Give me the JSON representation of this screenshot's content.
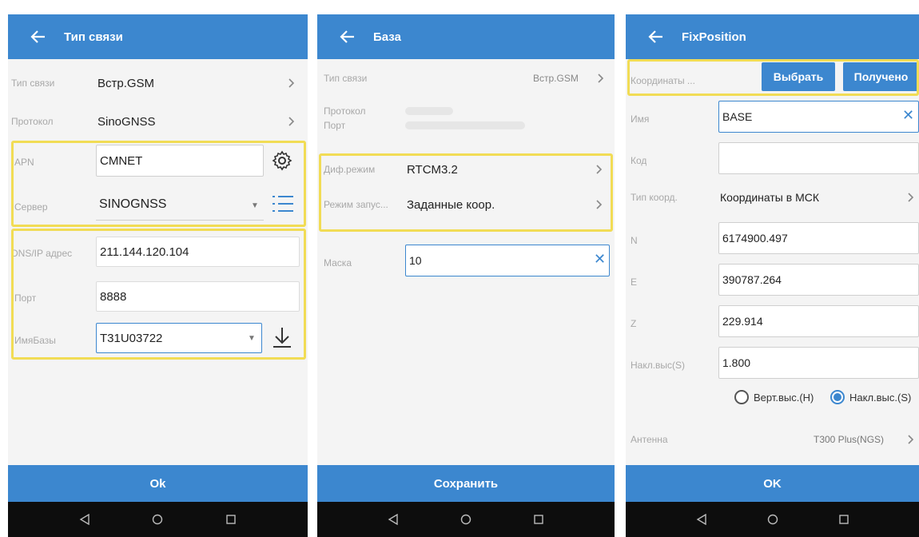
{
  "colors": {
    "primary": "#3c87cf",
    "highlight": "#f1dc55",
    "navbar": "#0d0d0d"
  },
  "screen1": {
    "title": "Тип связи",
    "rows": {
      "conn_type": {
        "label": "Тип связи",
        "value": "Встр.GSM"
      },
      "protocol": {
        "label": "Протокол",
        "value": "SinoGNSS"
      },
      "apn": {
        "label": "APN",
        "value": "CMNET"
      },
      "server": {
        "label": "Сервер",
        "value": "SINOGNSS"
      },
      "dns": {
        "label": "DNS/IP адрес",
        "value": "211.144.120.104"
      },
      "port": {
        "label": "Порт",
        "value": "8888"
      },
      "basename": {
        "label": "ИмяБазы",
        "value": "T31U03722"
      }
    },
    "ok_label": "Ok"
  },
  "screen2": {
    "title": "База",
    "rows": {
      "conn_type": {
        "label": "Тип связи",
        "value": "Встр.GSM"
      },
      "protocol": {
        "label": "Протокол"
      },
      "port": {
        "label": "Порт"
      },
      "diff_mode": {
        "label": "Диф.режим",
        "value": "RTCM3.2"
      },
      "start_mode": {
        "label": "Режим запус...",
        "value": "Заданные коор."
      },
      "mask": {
        "label": "Маска",
        "value": "10"
      }
    },
    "save_label": "Сохранить"
  },
  "screen3": {
    "title": "FixPosition",
    "coords": {
      "label": "Координаты ...",
      "select_label": "Выбрать",
      "received_label": "Получено"
    },
    "rows": {
      "name": {
        "label": "Имя",
        "value": "BASE"
      },
      "code": {
        "label": "Код",
        "value": ""
      },
      "coord_type": {
        "label": "Тип коорд.",
        "value": "Координаты в МСК"
      },
      "n": {
        "label": "N",
        "value": "6174900.497"
      },
      "e": {
        "label": "E",
        "value": "390787.264"
      },
      "z": {
        "label": "Z",
        "value": "229.914"
      },
      "tilt_height": {
        "label": "Накл.выс(S)",
        "value": "1.800"
      },
      "antenna": {
        "label": "Антенна",
        "value": "T300 Plus(NGS)"
      }
    },
    "radio": {
      "vertical": "Верт.выс.(H)",
      "slant": "Накл.выс.(S)",
      "selected": "slant"
    },
    "ok_label": "OK"
  }
}
